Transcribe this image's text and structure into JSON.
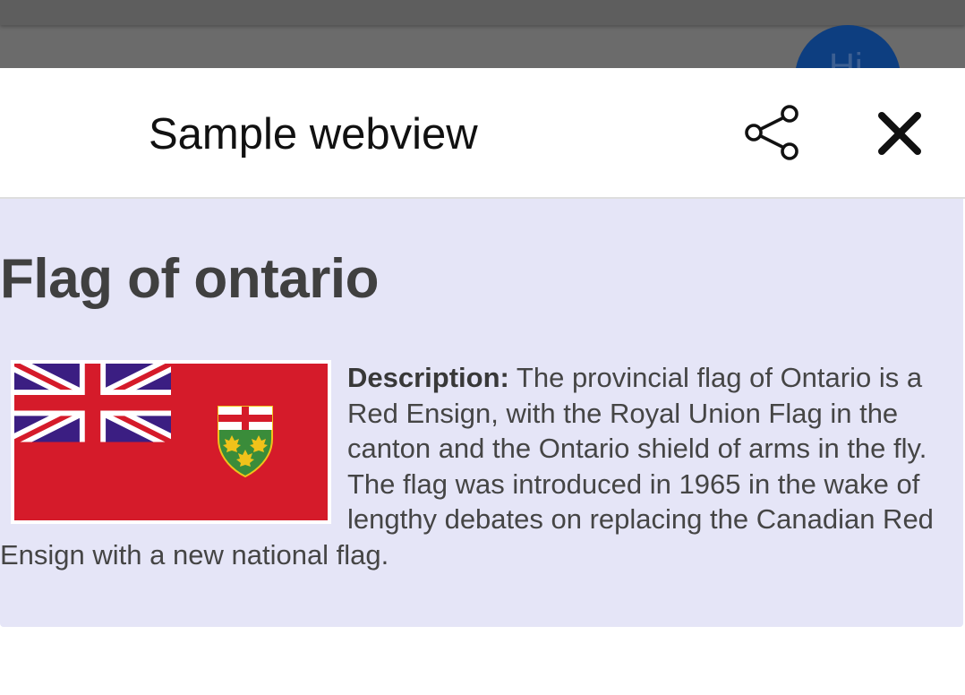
{
  "backdrop": {
    "avatar_initials": "Hi"
  },
  "header": {
    "title": "Sample webview",
    "share_icon": "share-icon",
    "close_icon": "close-icon"
  },
  "article": {
    "heading": "Flag of ontario",
    "description_label": "Description:",
    "description_text": " The provincial flag of Ontario is a Red Ensign, with the Royal Union Flag in the canton and the Ontario shield of arms in the fly. The flag was introduced in 1965 in the wake of lengthy debates on replacing the Canadian Red Ensign with a new national flag."
  },
  "colors": {
    "content_background": "#e5e5f7",
    "flag_red": "#d51b2a",
    "union_blue": "#3b1e82",
    "shield_green": "#3a8c3a",
    "maple_gold": "#f0c21a"
  }
}
